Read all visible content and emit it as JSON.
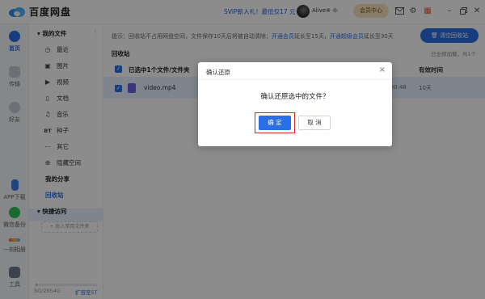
{
  "app": {
    "title": "百度网盘"
  },
  "titlebar": {
    "promo": "SVIP新人礼！最低仅17 元",
    "user_name": "Alive※",
    "vip_button": "会员中心",
    "icons": [
      "mail-icon",
      "gear-icon",
      "gift-icon",
      "minimize-icon",
      "restore-icon",
      "close-icon"
    ]
  },
  "rail": {
    "items": [
      {
        "label": "首页",
        "active": true
      },
      {
        "label": "传输"
      },
      {
        "label": "好友"
      },
      {
        "label": "APP下载"
      },
      {
        "label": "微信备份"
      },
      {
        "label": "一刻相册"
      },
      {
        "label": "工具"
      }
    ]
  },
  "sidebar": {
    "my_files": "我的文件",
    "items": [
      {
        "icon": "◷",
        "label": "最近"
      },
      {
        "icon": "▣",
        "label": "图片"
      },
      {
        "icon": "▶",
        "label": "视频"
      },
      {
        "icon": "▯",
        "label": "文档"
      },
      {
        "icon": "♫",
        "label": "音乐"
      },
      {
        "icon": "BT",
        "label": "种子"
      },
      {
        "icon": "⋯",
        "label": "其它"
      },
      {
        "icon": "⊕",
        "label": "隐藏空间"
      }
    ],
    "my_share": "我的分享",
    "recycle": "回收站",
    "quick_access": "快捷访问",
    "add_common": "+ 拖入常用文件夹",
    "storage_text": "5G/2054G",
    "storage_fraction": 0.03,
    "expand_link": "扩容至5T"
  },
  "main": {
    "tip_prefix": "提示：回收站不占用网盘空间，文件保存10天后将被自动清除；",
    "tip_link1": "开通会员",
    "tip_mid": "延长至15天，",
    "tip_link2": "开通超级会员",
    "tip_suffix": "延长至30天",
    "clear_button": "清空回收站",
    "page_title": "回收站",
    "count_right": "已全部加载，共1个",
    "selected_label": "已选中1个文件/文件夹",
    "col_valid": "有效时间",
    "rows": [
      {
        "name": "video.mp4",
        "time": "4 30:48",
        "valid": "10天"
      }
    ]
  },
  "dialog": {
    "title": "确认还原",
    "message": "确认还原选中的文件？",
    "ok": "确 定",
    "cancel": "取 消"
  }
}
